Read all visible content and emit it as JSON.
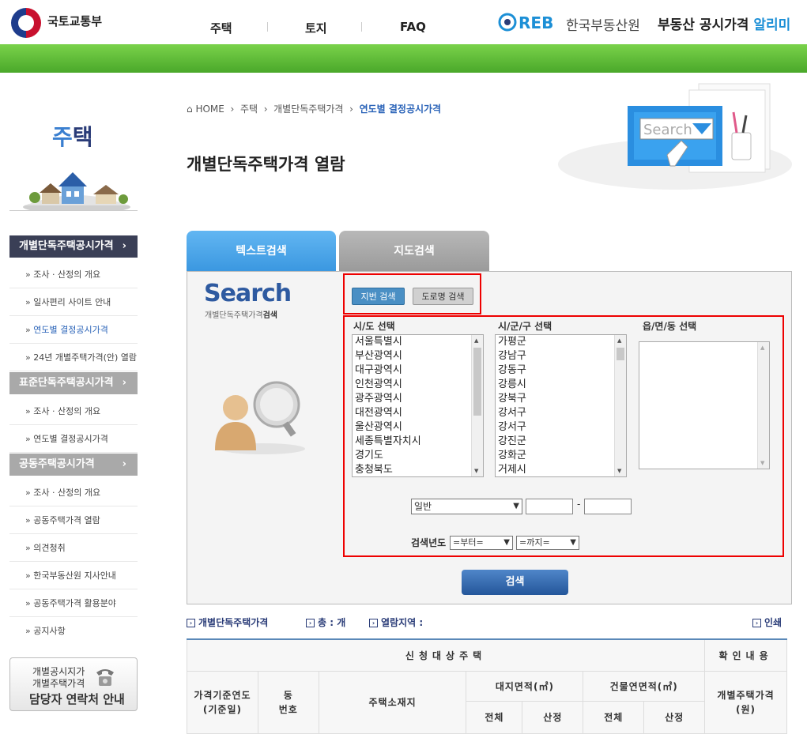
{
  "header": {
    "ministry": "국토교통부",
    "nav": [
      "주택",
      "토지",
      "FAQ"
    ],
    "org": "한국부동산원",
    "service_a": "부동산 공시가격",
    "service_b": "알리미"
  },
  "sidebar": {
    "title_a": "주",
    "title_b": "택",
    "sections": [
      {
        "label": "개별단독주택공시가격",
        "arrow": "›",
        "color": "#3a3f56"
      },
      {
        "label": "표준단독주택공시가격",
        "arrow": "›",
        "color": "#a9a9a9"
      },
      {
        "label": "공동주택공시가격",
        "arrow": "›",
        "color": "#a9a9a9"
      }
    ],
    "items_1": [
      "조사 · 산정의 개요",
      "일사편리 사이트 안내",
      "연도별 결정공시가격",
      "24년 개별주택가격(안) 열람"
    ],
    "items_2": [
      "조사 · 산정의 개요",
      "연도별 결정공시가격"
    ],
    "items_3": [
      "조사 · 산정의 개요",
      "공동주택가격 열람",
      "의견청취",
      "한국부동산원 지사안내",
      "공동주택가격 활용분야",
      "공지사항"
    ],
    "contact": {
      "line1": "개별공시지가",
      "line2": "개별주택가격",
      "line3": "담당자 연락처 안내"
    }
  },
  "breadcrumb": {
    "home": "HOME",
    "sep": "›",
    "level1": "주택",
    "level2": "개별단독주택가격",
    "current": "연도별 결정공시가격"
  },
  "page_title": "개별단독주택가격 열람",
  "illustration_text": "Search",
  "tabs": [
    "텍스트검색",
    "지도검색"
  ],
  "search": {
    "brand": "Search",
    "sub_a": "개별단독주택가격",
    "sub_b": "검색",
    "type_buttons": [
      "지번 검색",
      "도로명 검색"
    ],
    "col_sido": "시/도 선택",
    "col_sigungu": "시/군/구 선택",
    "col_eup": "읍/면/동 선택",
    "sido_list": [
      "서울특별시",
      "부산광역시",
      "대구광역시",
      "인천광역시",
      "광주광역시",
      "대전광역시",
      "울산광역시",
      "세종특별자치시",
      "경기도",
      "충청북도"
    ],
    "sigungu_list": [
      "가평군",
      "강남구",
      "강동구",
      "강릉시",
      "강북구",
      "강서구",
      "강서구",
      "강진군",
      "강화군",
      "거제시"
    ],
    "lot_type": "일반",
    "dash": "-",
    "year_label": "검색년도",
    "year_from": "=부터=",
    "year_to": "=까지=",
    "submit": "검색"
  },
  "info": {
    "title": "개별단독주택가격",
    "total": "총 : 개",
    "region": "열람지역 :",
    "print": "인쇄"
  },
  "table": {
    "group1": "신청대상주택",
    "group2": "확인내용",
    "col_year": "가격기준연도\n(기준일)",
    "col_dong": "동\n번호",
    "col_addr": "주택소재지",
    "col_land": "대지면적(㎡)",
    "col_bldg": "건물연면적(㎡)",
    "col_price": "개별주택가격\n(원)",
    "sub_total": "전체",
    "sub_calc": "산정"
  }
}
